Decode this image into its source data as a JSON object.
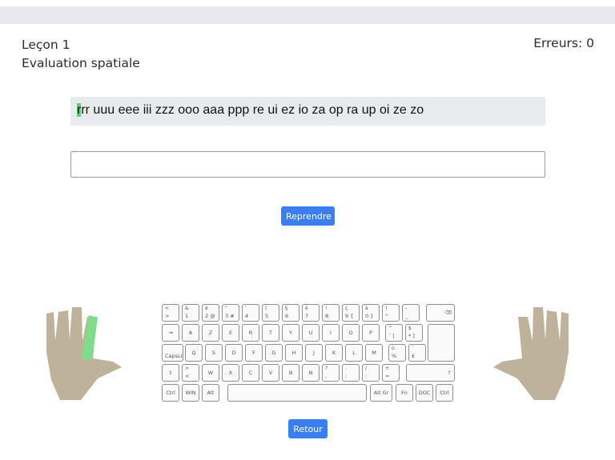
{
  "header": {
    "lesson": "Leçon 1",
    "subtitle": "Evaluation spatiale",
    "errors": "Erreurs: 0"
  },
  "exercise": {
    "current_char": "r",
    "rest": "rr uuu eee iii zzz ooo aaa ppp re ui ez io za op ra up oi ze zo"
  },
  "input": {
    "value": ""
  },
  "buttons": {
    "resume": "Reprendre",
    "back": "Retour"
  },
  "colors": {
    "accent": "#3b7ef0",
    "finger_highlight": "#7fdc8a",
    "hand": "#bfb29a",
    "panel": "#e9eaed"
  },
  "hands": {
    "highlighted_finger": "left-index"
  },
  "keyboard": {
    "rows": [
      [
        {
          "t": "<",
          "b": ">"
        },
        {
          "t": "&",
          "b": "1"
        },
        {
          "t": "é",
          "b": "2 @"
        },
        {
          "t": "\"",
          "b": "3 #"
        },
        {
          "t": "'",
          "b": "4"
        },
        {
          "t": "(",
          "b": "5"
        },
        {
          "t": "§",
          "b": "6"
        },
        {
          "t": "è",
          "b": "7"
        },
        {
          "t": "!",
          "b": "8"
        },
        {
          "t": "ç",
          "b": "9 {"
        },
        {
          "t": "à",
          "b": "0 }"
        },
        {
          "t": ")",
          "b": "°"
        },
        {
          "t": "-",
          "b": "_"
        },
        {
          "r": "⌫"
        }
      ],
      [
        {
          "c": "⇥"
        },
        {
          "c": "A"
        },
        {
          "c": "Z"
        },
        {
          "c": "E"
        },
        {
          "c": "R"
        },
        {
          "c": "T"
        },
        {
          "c": "Y"
        },
        {
          "c": "U"
        },
        {
          "c": "I"
        },
        {
          "c": "O"
        },
        {
          "c": "P"
        },
        {
          "t": "^",
          "b": "¨ ["
        },
        {
          "t": "$",
          "b": "* ]"
        }
      ],
      [
        {
          "b": "CapsLock"
        },
        {
          "c": "Q"
        },
        {
          "c": "S"
        },
        {
          "c": "D"
        },
        {
          "c": "F"
        },
        {
          "c": "G"
        },
        {
          "c": "H"
        },
        {
          "c": "J"
        },
        {
          "c": "K"
        },
        {
          "c": "L"
        },
        {
          "c": "M"
        },
        {
          "t": "ù",
          "b": "%"
        },
        {
          "t": "`",
          "b": "£"
        },
        {
          "r": "↵"
        }
      ],
      [
        {
          "c": "⇧"
        },
        {
          "t": ">",
          "b": "<"
        },
        {
          "c": "W"
        },
        {
          "c": "X"
        },
        {
          "c": "C"
        },
        {
          "c": "V"
        },
        {
          "c": "B"
        },
        {
          "c": "N"
        },
        {
          "t": "?",
          "b": ","
        },
        {
          "t": ".",
          "b": ";"
        },
        {
          "t": "/",
          "b": ":"
        },
        {
          "t": "+",
          "b": "="
        },
        {
          "r": "⇧"
        }
      ],
      [
        {
          "c": "Ctrl"
        },
        {
          "c": "WIN"
        },
        {
          "c": "Alt"
        },
        {
          "c": ""
        },
        {
          "c": "Alt Gr"
        },
        {
          "c": "Fn"
        },
        {
          "c": "DOC"
        },
        {
          "c": "Ctrl"
        }
      ]
    ]
  }
}
